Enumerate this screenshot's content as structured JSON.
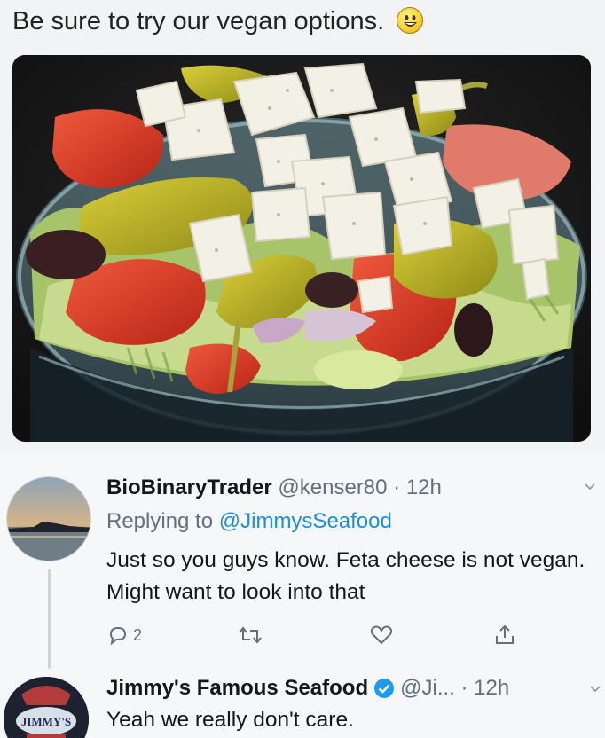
{
  "post": {
    "text": "Be sure to try our vegan options.",
    "emoji": "smiley-face-icon"
  },
  "reply1": {
    "display_name": "BioBinaryTrader",
    "handle_time": "@kenser80 · 12h",
    "replying_prefix": "Replying to",
    "replying_to": "@JimmysSeafood",
    "body": "Just so you guys know. Feta cheese is not vegan.  Might want to look into that",
    "reply_count": "2"
  },
  "reply2": {
    "display_name": "Jimmy's Famous Seafood",
    "handle_time": "@Ji... · 12h",
    "body": "Yeah we really don't care.",
    "avatar_text": "JIMMY'S"
  },
  "colors": {
    "link": "#1b8fd8",
    "muted": "#60707c",
    "verified": "#1d9bf0"
  }
}
